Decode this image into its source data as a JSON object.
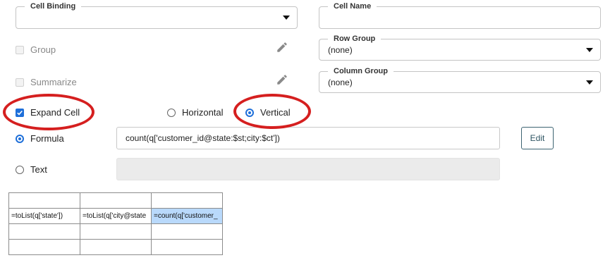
{
  "cell_binding": {
    "legend": "Cell Binding",
    "value": ""
  },
  "cell_name": {
    "legend": "Cell Name",
    "value": ""
  },
  "row_group": {
    "legend": "Row Group",
    "value": "(none)"
  },
  "column_group": {
    "legend": "Column Group",
    "value": "(none)"
  },
  "group": {
    "label": "Group",
    "checked": false,
    "disabled": true
  },
  "summarize": {
    "label": "Summarize",
    "checked": false,
    "disabled": true
  },
  "expand_cell": {
    "label": "Expand Cell",
    "checked": true
  },
  "orientation": {
    "horizontal_label": "Horizontal",
    "vertical_label": "Vertical",
    "selected": "Vertical"
  },
  "formula": {
    "label": "Formula",
    "selected": true,
    "value": "count(q['customer_id@state:$st;city:$ct'])"
  },
  "text": {
    "label": "Text",
    "selected": false,
    "value": ""
  },
  "edit_button": {
    "label": "Edit"
  },
  "grid": {
    "rows": [
      [
        "",
        "",
        ""
      ],
      [
        "=toList(q['state'])",
        "=toList(q['city@state",
        "=count(q['customer_"
      ],
      [
        "",
        "",
        ""
      ],
      [
        "",
        "",
        ""
      ]
    ]
  },
  "colors": {
    "accent": "#1e6fd9",
    "highlight_ring": "#d51f1f",
    "selected_cell": "#b9d9fb"
  },
  "icons": [
    "dropdown-caret-icon",
    "pencil-icon"
  ]
}
